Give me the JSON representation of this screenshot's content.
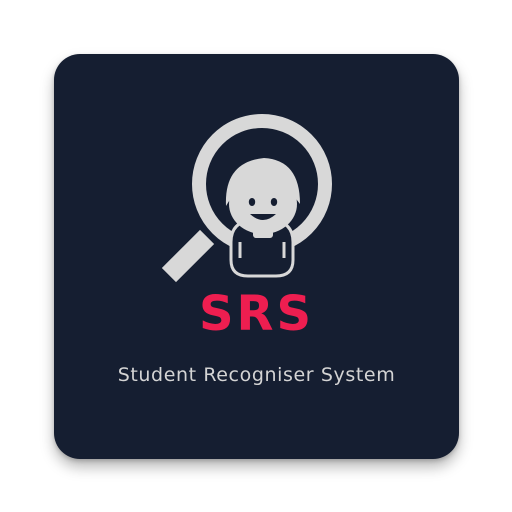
{
  "app_icon": {
    "acronym": "SRS",
    "full_name": "Student Recogniser System",
    "logo_icon": "magnifier-student-icon",
    "colors": {
      "background": "#151e31",
      "accent": "#ee1e50",
      "logo": "#d8d8d8",
      "text": "#d4d4d4"
    }
  }
}
